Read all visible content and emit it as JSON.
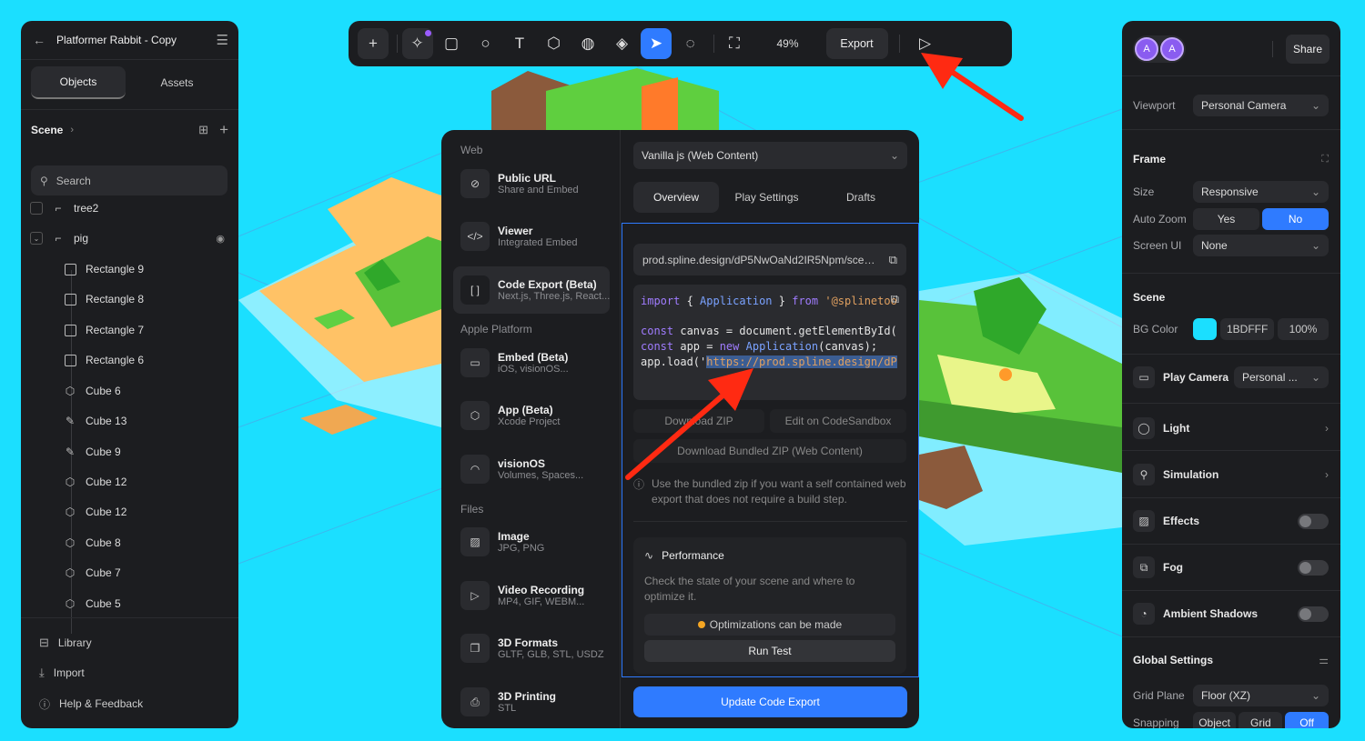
{
  "colors": {
    "background": "#1BDFFF",
    "panel": "#1c1d20",
    "accent": "#2f7bff",
    "arrow": "#ff2a12"
  },
  "left_panel": {
    "project_title": "Platformer Rabbit - Copy",
    "tabs": [
      "Objects",
      "Assets"
    ],
    "scene_label": "Scene",
    "search_placeholder": "Search",
    "tree": [
      {
        "label": "tree2",
        "icon": "group-icon"
      },
      {
        "label": "pig",
        "icon": "group-icon"
      },
      {
        "label": "Rectangle 9",
        "icon": "rectangle-icon"
      },
      {
        "label": "Rectangle 8",
        "icon": "rectangle-icon"
      },
      {
        "label": "Rectangle 7",
        "icon": "rectangle-icon"
      },
      {
        "label": "Rectangle 6",
        "icon": "rectangle-icon"
      },
      {
        "label": "Cube 6",
        "icon": "cube-icon"
      },
      {
        "label": "Cube 13",
        "icon": "pen-icon"
      },
      {
        "label": "Cube 9",
        "icon": "pen-icon"
      },
      {
        "label": "Cube 12",
        "icon": "cube-icon"
      },
      {
        "label": "Cube 12",
        "icon": "cube-icon"
      },
      {
        "label": "Cube 8",
        "icon": "cube-icon"
      },
      {
        "label": "Cube 7",
        "icon": "cube-icon"
      },
      {
        "label": "Cube 5",
        "icon": "cube-icon"
      }
    ],
    "footer": [
      "Library",
      "Import",
      "Help & Feedback"
    ]
  },
  "toolbar": {
    "zoom": "49%",
    "export_label": "Export"
  },
  "export_dialog": {
    "sections": {
      "web": "Web",
      "apple": "Apple Platform",
      "files": "Files"
    },
    "items": [
      {
        "title": "Public URL",
        "sub": "Share and Embed"
      },
      {
        "title": "Viewer",
        "sub": "Integrated Embed"
      },
      {
        "title": "Code Export (Beta)",
        "sub": "Next.js, Three.js, React..."
      },
      {
        "title": "Embed (Beta)",
        "sub": "iOS, visionOS..."
      },
      {
        "title": "App (Beta)",
        "sub": "Xcode Project"
      },
      {
        "title": "visionOS",
        "sub": "Volumes, Spaces..."
      },
      {
        "title": "Image",
        "sub": "JPG, PNG"
      },
      {
        "title": "Video Recording",
        "sub": "MP4, GIF, WEBM..."
      },
      {
        "title": "3D Formats",
        "sub": "GLTF, GLB, STL, USDZ"
      },
      {
        "title": "3D Printing",
        "sub": "STL"
      }
    ],
    "framework_select": "Vanilla js (Web Content)",
    "tabs": [
      "Overview",
      "Play Settings",
      "Drafts"
    ],
    "url": "prod.spline.design/dP5NwOaNd2IR5Npm/scene...",
    "code": {
      "l1_import": "import",
      "l1_brace_open": " { ",
      "l1_app": "Application",
      "l1_brace_close": " } ",
      "l1_from": "from",
      "l1_str": " '@splinetoo",
      "l2_const": "const",
      "l2_var": " canvas ",
      "l2_eq": "= ",
      "l2_rest": "document.getElementById(",
      "l3_const": "const",
      "l3_var": " app ",
      "l3_eq": "= ",
      "l3_new": "new",
      "l3_app": " Application",
      "l3_rest": "(canvas);",
      "l4_load": "app.load('",
      "l4_url": "https://prod.spline.design/dP"
    },
    "download_zip": "Download ZIP",
    "edit_codesandbox": "Edit on CodeSandbox",
    "download_bundled": "Download Bundled ZIP (Web Content)",
    "info_text": "Use the bundled zip if you want a self contained web export that does not require a build step.",
    "performance_title": "Performance",
    "performance_desc": "Check the state of your scene and where to optimize it.",
    "optimizations": "Optimizations can be made",
    "run_test": "Run Test",
    "update_button": "Update Code Export"
  },
  "right_panel": {
    "avatars": [
      "A",
      "A"
    ],
    "share_label": "Share",
    "viewport_label": "Viewport",
    "viewport_value": "Personal Camera",
    "frame_title": "Frame",
    "size_label": "Size",
    "size_value": "Responsive",
    "autozoom_label": "Auto Zoom",
    "autozoom_yes": "Yes",
    "autozoom_no": "No",
    "screenui_label": "Screen UI",
    "screenui_value": "None",
    "scene_title": "Scene",
    "bgcolor_label": "BG Color",
    "bgcolor_hex": "1BDFFF",
    "bgcolor_opacity": "100%",
    "play_camera_label": "Play Camera",
    "play_camera_value": "Personal ...",
    "light": "Light",
    "simulation": "Simulation",
    "effects": "Effects",
    "fog": "Fog",
    "ambient_shadows": "Ambient Shadows",
    "global_settings": "Global Settings",
    "grid_plane_label": "Grid Plane",
    "grid_plane_value": "Floor (XZ)",
    "snapping_label": "Snapping",
    "snapping_options": [
      "Object",
      "Grid",
      "Off"
    ]
  }
}
